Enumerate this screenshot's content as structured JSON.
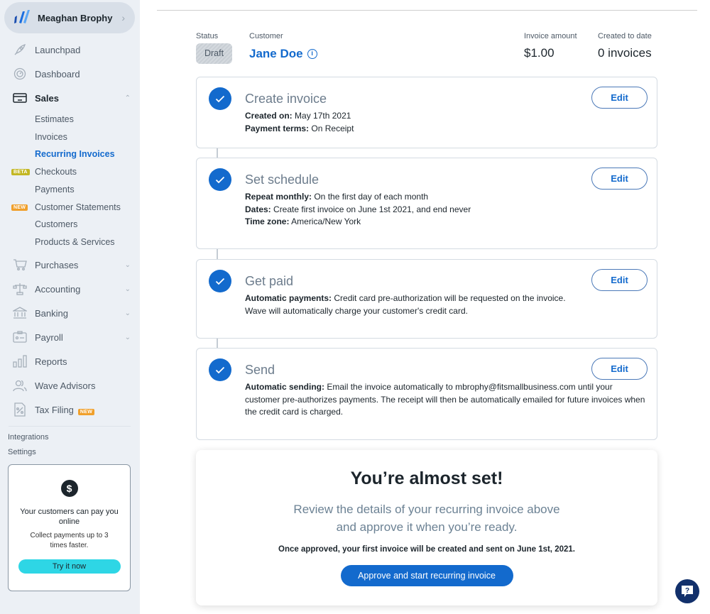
{
  "sidebar": {
    "business_name": "Meaghan Brophy",
    "nav": [
      {
        "label": "Launchpad",
        "icon": "rocket-icon"
      },
      {
        "label": "Dashboard",
        "icon": "dashboard-icon"
      },
      {
        "label": "Sales",
        "icon": "credit-card-icon",
        "expanded": true
      },
      {
        "label": "Purchases",
        "icon": "cart-icon"
      },
      {
        "label": "Accounting",
        "icon": "scale-icon"
      },
      {
        "label": "Banking",
        "icon": "bank-icon"
      },
      {
        "label": "Payroll",
        "icon": "id-card-icon"
      },
      {
        "label": "Reports",
        "icon": "bar-chart-icon"
      },
      {
        "label": "Wave Advisors",
        "icon": "people-icon"
      },
      {
        "label": "Tax Filing",
        "icon": "percent-doc-icon",
        "badge": "NEW"
      }
    ],
    "sales_sub": [
      {
        "label": "Estimates"
      },
      {
        "label": "Invoices"
      },
      {
        "label": "Recurring Invoices",
        "active": true
      },
      {
        "label": "Checkouts",
        "badge": "BETA"
      },
      {
        "label": "Payments"
      },
      {
        "label": "Customer Statements",
        "badge": "NEW"
      },
      {
        "label": "Customers"
      },
      {
        "label": "Products & Services"
      }
    ],
    "bottom_links": [
      "Integrations",
      "Settings"
    ],
    "promo": {
      "title": "Your customers can pay you online",
      "text": "Collect payments up to 3 times faster.",
      "button": "Try it now"
    }
  },
  "header": {
    "status_label": "Status",
    "status_value": "Draft",
    "customer_label": "Customer",
    "customer_name": "Jane Doe",
    "amount_label": "Invoice amount",
    "amount_value": "$1.00",
    "created_label": "Created to date",
    "created_value": "0 invoices"
  },
  "steps": [
    {
      "title": "Create invoice",
      "edit": "Edit",
      "lines": [
        {
          "k": "Created on:",
          "v": " May 17th 2021"
        },
        {
          "k": "Payment terms:",
          "v": " On Receipt"
        }
      ]
    },
    {
      "title": "Set schedule",
      "edit": "Edit",
      "lines": [
        {
          "k": "Repeat monthly:",
          "v": " On the first day of each month"
        },
        {
          "k": "Dates:",
          "v": " Create first invoice on June 1st 2021, and end never"
        },
        {
          "k": "Time zone:",
          "v": " America/New York"
        }
      ]
    },
    {
      "title": "Get paid",
      "edit": "Edit",
      "lines": [
        {
          "k": "Automatic payments:",
          "v": " Credit card pre-authorization will be requested on the invoice. Wave will automatically charge your customer's credit card."
        }
      ]
    },
    {
      "title": "Send",
      "edit": "Edit",
      "lines": [
        {
          "k": "Automatic sending:",
          "v": " Email the invoice automatically to mbrophy@fitsmallbusiness.com until your customer pre-authorizes payments. The receipt will then be automatically emailed for future invoices when the credit card is charged."
        }
      ]
    }
  ],
  "final": {
    "heading": "You’re almost set!",
    "subtitle_1": "Review the details of your recurring invoice above",
    "subtitle_2": "and approve it when you’re ready.",
    "note": "Once approved, your first invoice will be created and sent on June 1st, 2021.",
    "approve_button": "Approve and start recurring invoice"
  },
  "colors": {
    "accent": "#136acd",
    "sidebar_bg": "#ecf0f5",
    "promo_button": "#2ed6e5",
    "beta_badge": "#c3b724",
    "new_badge": "#f0a02c"
  }
}
